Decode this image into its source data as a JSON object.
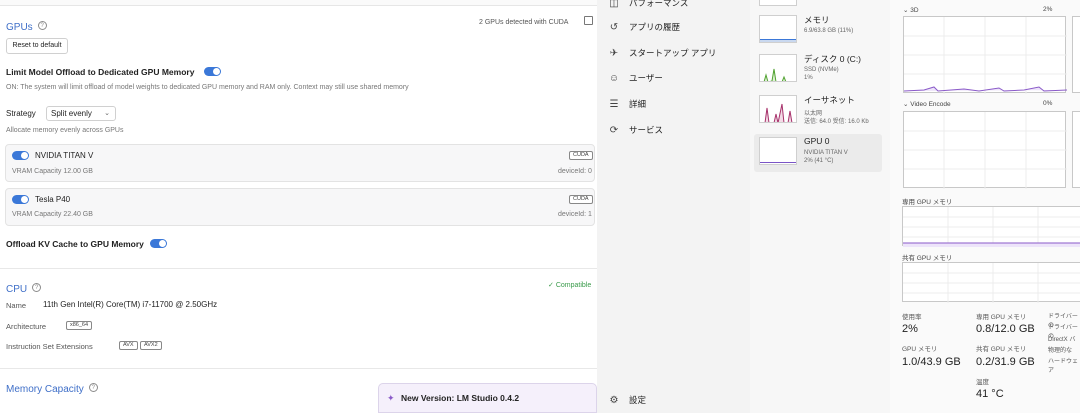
{
  "lm": {
    "gpus_title": "GPUs",
    "gpus_detected": "2 GPUs detected with CUDA",
    "reset_label": "Reset to default",
    "offload_title": "Limit Model Offload to Dedicated GPU Memory",
    "offload_desc": "ON: The system will limit offload of model weights to dedicated GPU memory and RAM only. Context may still use shared memory",
    "strategy_label": "Strategy",
    "strategy_value": "Split evenly",
    "strategy_desc": "Allocate memory evenly across GPUs",
    "gpus": [
      {
        "name": "NVIDIA TITAN V",
        "vram": "VRAM Capacity 12.00 GB",
        "badge": "CUDA",
        "device": "deviceId: 0"
      },
      {
        "name": "Tesla P40",
        "vram": "VRAM Capacity 22.40 GB",
        "badge": "CUDA",
        "device": "deviceId: 1"
      }
    ],
    "kv_title": "Offload KV Cache to GPU Memory",
    "cpu_title": "CPU",
    "cpu_compat": "Compatible",
    "cpu_name_label": "Name",
    "cpu_name_value": "11th Gen Intel(R) Core(TM) i7-11700 @ 2.50GHz",
    "arch_label": "Architecture",
    "arch_value": "x86_64",
    "ise_label": "Instruction Set Extensions",
    "ise_values": [
      "AVX",
      "AVX2"
    ],
    "mem_title": "Memory Capacity",
    "accent": "#3b78d8",
    "compat_color": "#3a9b4b"
  },
  "toast": {
    "title": "New Version: LM Studio 0.4.2"
  },
  "nav": {
    "items": [
      {
        "icon": "performance-icon",
        "label": "パフォーマンス"
      },
      {
        "icon": "history-icon",
        "label": "アプリの履歴"
      },
      {
        "icon": "startup-icon",
        "label": "スタートアップ アプリ"
      },
      {
        "icon": "users-icon",
        "label": "ユーザー"
      },
      {
        "icon": "details-icon",
        "label": "詳細"
      },
      {
        "icon": "services-icon",
        "label": "サービス"
      }
    ],
    "settings": "設定"
  },
  "resources": [
    {
      "name": "メモリ",
      "sub1": "6.9/63.8 GB (11%)"
    },
    {
      "name": "ディスク 0 (C:)",
      "sub1": "SSD (NVMe)",
      "sub2": "1%"
    },
    {
      "name": "イーサネット",
      "sub1": "以太网",
      "sub2": "送信: 64.0 受信: 16.0 Kb"
    },
    {
      "name": "GPU 0",
      "sub1": "NVIDIA TITAN V",
      "sub2": "2% (41 °C)"
    }
  ],
  "detail": {
    "engine_3d": "3D",
    "engine_3d_pct": "2%",
    "engine_video": "Video Encode",
    "engine_video_pct": "0%",
    "dedicated_mem": "専用 GPU メモリ",
    "shared_mem": "共有 GPU メモリ",
    "usage_label": "使用率",
    "usage_value": "2%",
    "ded_label": "専用 GPU メモリ",
    "ded_value": "0.8/12.0 GB",
    "gpu_mem_label": "GPU メモリ",
    "gpu_mem_value": "1.0/43.9 GB",
    "shared_label": "共有 GPU メモリ",
    "shared_value": "0.2/31.9 GB",
    "temp_label": "温度",
    "temp_value": "41 °C",
    "side_lines": [
      "ドライバーの",
      "ドライバーの",
      "DirectX バ",
      "物理的な",
      "ハードウェア"
    ]
  }
}
